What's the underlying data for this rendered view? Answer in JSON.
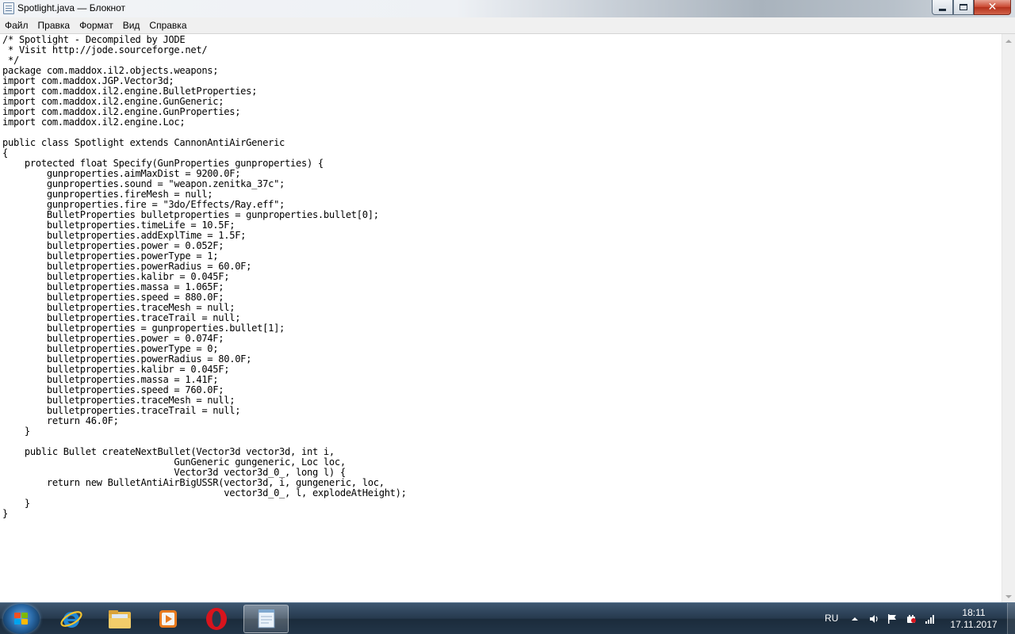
{
  "window": {
    "title": "Spotlight.java — Блокнот"
  },
  "menu": {
    "items": [
      "Файл",
      "Правка",
      "Формат",
      "Вид",
      "Справка"
    ]
  },
  "editor": {
    "lines": [
      "/* Spotlight - Decompiled by JODE",
      " * Visit http://jode.sourceforge.net/",
      " */",
      "package com.maddox.il2.objects.weapons;",
      "import com.maddox.JGP.Vector3d;",
      "import com.maddox.il2.engine.BulletProperties;",
      "import com.maddox.il2.engine.GunGeneric;",
      "import com.maddox.il2.engine.GunProperties;",
      "import com.maddox.il2.engine.Loc;",
      "",
      "public class Spotlight extends CannonAntiAirGeneric",
      "{",
      "    protected float Specify(GunProperties gunproperties) {",
      "        gunproperties.aimMaxDist = 9200.0F;",
      "        gunproperties.sound = \"weapon.zenitka_37c\";",
      "        gunproperties.fireMesh = null;",
      "        gunproperties.fire = \"3do/Effects/Ray.eff\";",
      "        BulletProperties bulletproperties = gunproperties.bullet[0];",
      "        bulletproperties.timeLife = 10.5F;",
      "        bulletproperties.addExplTime = 1.5F;",
      "        bulletproperties.power = 0.052F;",
      "        bulletproperties.powerType = 1;",
      "        bulletproperties.powerRadius = 60.0F;",
      "        bulletproperties.kalibr = 0.045F;",
      "        bulletproperties.massa = 1.065F;",
      "        bulletproperties.speed = 880.0F;",
      "        bulletproperties.traceMesh = null;",
      "        bulletproperties.traceTrail = null;",
      "        bulletproperties = gunproperties.bullet[1];",
      "        bulletproperties.power = 0.074F;",
      "        bulletproperties.powerType = 0;",
      "        bulletproperties.powerRadius = 80.0F;",
      "        bulletproperties.kalibr = 0.045F;",
      "        bulletproperties.massa = 1.41F;",
      "        bulletproperties.speed = 760.0F;",
      "        bulletproperties.traceMesh = null;",
      "        bulletproperties.traceTrail = null;",
      "        return 46.0F;",
      "    }",
      "",
      "    public Bullet createNextBullet(Vector3d vector3d, int i,",
      "                               GunGeneric gungeneric, Loc loc,",
      "                               Vector3d vector3d_0_, long l) {",
      "        return new BulletAntiAirBigUSSR(vector3d, i, gungeneric, loc,",
      "                                        vector3d_0_, l, explodeAtHeight);",
      "    }",
      "}"
    ]
  },
  "taskbar": {
    "pinned": [
      {
        "name": "internet-explorer",
        "icon": "ie-icon"
      },
      {
        "name": "windows-explorer",
        "icon": "folder-icon"
      },
      {
        "name": "media-player",
        "icon": "media-player-icon"
      },
      {
        "name": "opera",
        "icon": "opera-icon"
      },
      {
        "name": "notepad",
        "icon": "notepad-icon",
        "active": true
      }
    ],
    "tray": {
      "language": "RU",
      "icons": [
        "chevron-up-icon",
        "speaker-icon",
        "flag-icon",
        "power-icon",
        "network-icon"
      ]
    },
    "clock": {
      "time": "18:11",
      "date": "17.11.2017"
    }
  },
  "colors": {
    "titlebar": "#eef1f5",
    "close_button": "#c9472f",
    "taskbar": "#26394d",
    "editor_bg": "#ffffff"
  }
}
